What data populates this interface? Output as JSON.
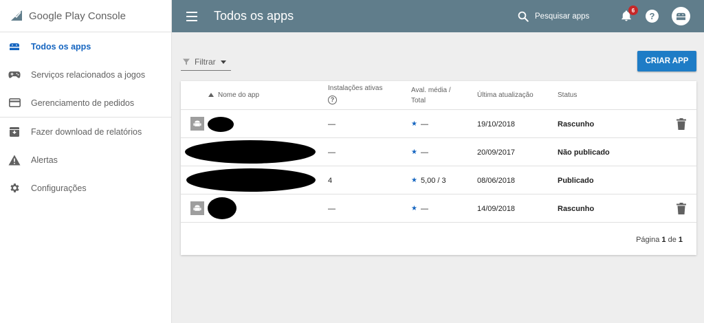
{
  "brand": {
    "name_a": "Google Play",
    "name_b": " Console"
  },
  "sidebar": {
    "items": [
      {
        "label": "Todos os apps",
        "icon": "android-icon",
        "active": true
      },
      {
        "label": "Serviços relacionados a jogos",
        "icon": "gamepad-icon"
      },
      {
        "label": "Gerenciamento de pedidos",
        "icon": "credit-card-icon"
      },
      {
        "label": "Fazer download de relatórios",
        "icon": "download-box-icon"
      },
      {
        "label": "Alertas",
        "icon": "warning-icon"
      },
      {
        "label": "Configurações",
        "icon": "gear-icon"
      }
    ]
  },
  "header": {
    "title": "Todos os apps",
    "search_label": "Pesquisar apps",
    "notifications_count": "6",
    "help_label": "?"
  },
  "toolbar": {
    "filter_label": "Filtrar",
    "create_label": "CRIAR APP"
  },
  "table": {
    "columns": {
      "name": "Nome do app",
      "installs": "Instalações ativas",
      "rating_a": "Aval. média /",
      "rating_b": "Total",
      "updated": "Última atualização",
      "status": "Status"
    },
    "rows": [
      {
        "installs": "—",
        "rating": "—",
        "updated": "19/10/2018",
        "status": "Rascunho"
      },
      {
        "installs": "—",
        "rating": "—",
        "updated": "20/09/2017",
        "status": "Não publicado"
      },
      {
        "installs": "4",
        "rating": "5,00 / 3",
        "updated": "08/06/2018",
        "status": "Publicado"
      },
      {
        "installs": "—",
        "rating": "—",
        "updated": "14/09/2018",
        "status": "Rascunho"
      }
    ]
  },
  "pager": {
    "prefix": "Página ",
    "current": "1",
    "middle": " de ",
    "total": "1"
  },
  "colors": {
    "header_bg": "#607d8b",
    "accent": "#1e7cc6",
    "active_nav": "#1565c0",
    "badge": "#c62828"
  }
}
